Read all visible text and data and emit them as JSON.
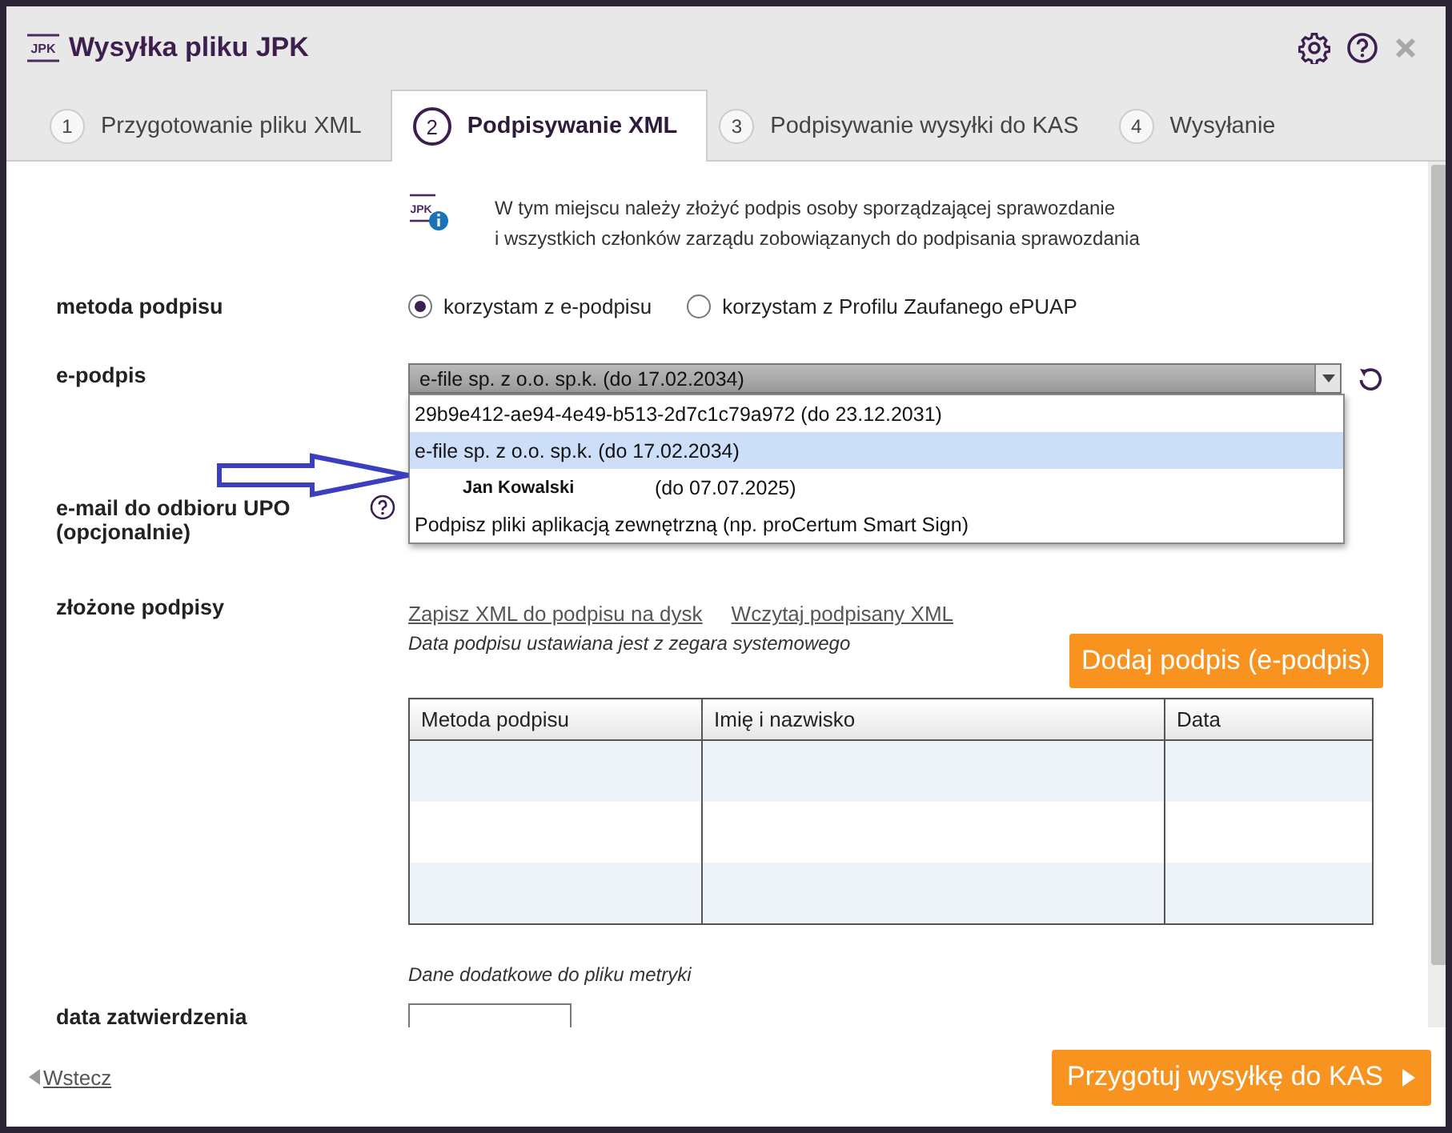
{
  "window": {
    "logo": "JPK",
    "title": "Wysyłka pliku JPK"
  },
  "tabs": [
    {
      "number": "1",
      "label": "Przygotowanie pliku XML",
      "selected": false
    },
    {
      "number": "2",
      "label": "Podpisywanie XML",
      "selected": true
    },
    {
      "number": "3",
      "label": "Podpisywanie wysyłki do KAS",
      "selected": false
    },
    {
      "number": "4",
      "label": "Wysyłanie",
      "selected": false
    }
  ],
  "info": {
    "icon_text": "JPK",
    "text": "W tym miejscu należy złożyć podpis osoby sporządzającej sprawozdanie\ni wszystkich członków zarządu zobowiązanych do podpisania sprawozdania"
  },
  "signature_method": {
    "label": "metoda podpisu",
    "options": [
      {
        "label": "korzystam z e-podpisu",
        "selected": true
      },
      {
        "label": "korzystam z Profilu Zaufanego ePUAP",
        "selected": false
      }
    ]
  },
  "e_signature": {
    "label": "e-podpis",
    "value": "e-file sp. z o.o. sp.k. (do 17.02.2034)",
    "expanded": true,
    "options": [
      {
        "text": "29b9e412-ae94-4e49-b513-2d7c1c79a972 (do 23.12.2031)",
        "selected": false
      },
      {
        "text": "e-file sp. z o.o. sp.k. (do 17.02.2034)",
        "selected": true
      },
      {
        "name": "Jan Kowalski",
        "text": "(do 07.07.2025)",
        "selected": false
      },
      {
        "text": "Podpisz pliki aplikacją zewnętrzną (np. proCertum Smart Sign)",
        "selected": false
      }
    ]
  },
  "email": {
    "label": "e-mail do odbioru UPO (opcjonalnie)"
  },
  "signatures": {
    "label": "złożone podpisy",
    "links": [
      "Zapisz XML do podpisu na dysk",
      "Wczytaj podpisany XML"
    ],
    "note": "Data podpisu ustawiana jest z zegara systemowego",
    "add_button": "Dodaj podpis (e-podpis)",
    "table": {
      "columns": [
        "Metoda podpisu",
        "Imię i nazwisko",
        "Data"
      ]
    }
  },
  "metadata": {
    "note": "Dane dodatkowe do pliku metryki",
    "approval_date": {
      "label": "data zatwierdzenia"
    }
  },
  "footer": {
    "back": "Wstecz",
    "next": "Przygotuj wysyłkę do KAS"
  }
}
